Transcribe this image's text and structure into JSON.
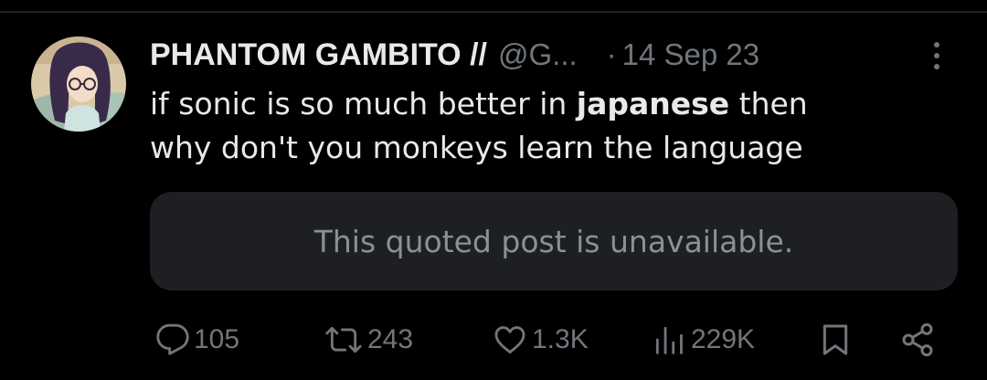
{
  "tweet": {
    "display_name": "PHANTOM GAMBITO //",
    "handle": "@G...",
    "separator": "·",
    "timestamp": "14 Sep 23",
    "text_line1_before": "if sonic is so much better in ",
    "text_line1_bold": "japanese",
    "text_line1_after": " then",
    "text_line2": "why don't you monkeys learn the language"
  },
  "quote": {
    "message": "This quoted post is unavailable."
  },
  "actions": {
    "replies": "105",
    "reposts": "243",
    "likes": "1.3K",
    "views": "229K"
  },
  "icons": {
    "more": "more-vertical-icon",
    "reply": "reply-icon",
    "repost": "repost-icon",
    "like": "heart-icon",
    "views": "views-chart-icon",
    "bookmark": "bookmark-icon",
    "share": "share-icon"
  },
  "colors": {
    "background": "#000000",
    "primary_text": "#e7e9ea",
    "secondary_text": "#71767b",
    "quote_background": "#1d1f23",
    "quote_text": "#8b9096"
  }
}
